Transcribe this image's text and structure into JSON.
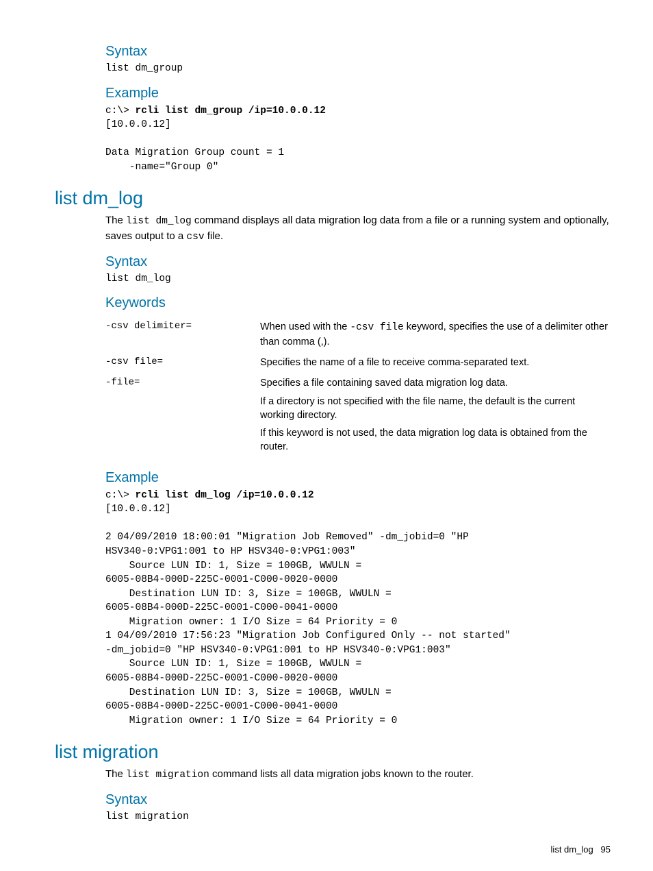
{
  "sec1": {
    "syntax_h": "Syntax",
    "syntax_code": "list dm_group",
    "example_h": "Example",
    "example_prompt": "c:\\> ",
    "example_cmd": "rcli list dm_group /ip=10.0.0.12",
    "example_out": "[10.0.0.12]\n\nData Migration Group count = 1\n    -name=\"Group 0\""
  },
  "sec2": {
    "title": "list dm_log",
    "intro_pre": "The ",
    "intro_code": "list dm_log",
    "intro_mid": " command displays all data migration log data from a file or a running system and optionally, saves output to a ",
    "intro_code2": "csv",
    "intro_post": " file.",
    "syntax_h": "Syntax",
    "syntax_code": "list dm_log",
    "keywords_h": "Keywords",
    "kw": [
      {
        "k": "-csv delimiter=",
        "d_pre": "When used with the ",
        "d_code": "-csv file",
        "d_post": " keyword, specifies the use of a delimiter other than comma (,)."
      },
      {
        "k": "-csv file=",
        "d": "Specifies the name of a file to receive comma-separated text."
      },
      {
        "k": "-file=",
        "d1": "Specifies a file containing saved data migration log data.",
        "d2": "If a directory is not specified with the file name, the default is the current working directory.",
        "d3": "If this keyword is not used, the data migration log data is obtained from the router."
      }
    ],
    "example_h": "Example",
    "example_prompt": "c:\\> ",
    "example_cmd": "rcli list dm_log /ip=10.0.0.12",
    "example_out": "[10.0.0.12]\n\n2 04/09/2010 18:00:01 \"Migration Job Removed\" -dm_jobid=0 \"HP\nHSV340-0:VPG1:001 to HP HSV340-0:VPG1:003\"\n    Source LUN ID: 1, Size = 100GB, WWULN =\n6005-08B4-000D-225C-0001-C000-0020-0000\n    Destination LUN ID: 3, Size = 100GB, WWULN =\n6005-08B4-000D-225C-0001-C000-0041-0000\n    Migration owner: 1 I/O Size = 64 Priority = 0\n1 04/09/2010 17:56:23 \"Migration Job Configured Only -- not started\"\n-dm_jobid=0 \"HP HSV340-0:VPG1:001 to HP HSV340-0:VPG1:003\"\n    Source LUN ID: 1, Size = 100GB, WWULN =\n6005-08B4-000D-225C-0001-C000-0020-0000\n    Destination LUN ID: 3, Size = 100GB, WWULN =\n6005-08B4-000D-225C-0001-C000-0041-0000\n    Migration owner: 1 I/O Size = 64 Priority = 0"
  },
  "sec3": {
    "title": "list migration",
    "intro_pre": "The ",
    "intro_code": "list migration",
    "intro_post": " command lists all data migration jobs known to the router.",
    "syntax_h": "Syntax",
    "syntax_code": "list migration"
  },
  "footer": {
    "label": "list dm_log",
    "page": "95"
  }
}
